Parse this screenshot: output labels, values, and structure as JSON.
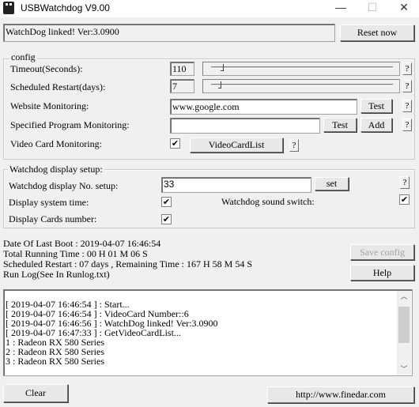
{
  "window": {
    "title": "USBWatchdog V9.00"
  },
  "status": {
    "text": "WatchDog linked! Ver:3.0900",
    "reset_label": "Reset now"
  },
  "config": {
    "label": "config",
    "timeout_label": "Timeout(Seconds):",
    "timeout_value": "110",
    "timeout_slider_fraction": 0.05,
    "restart_label": "Scheduled Restart(days):",
    "restart_value": "7",
    "restart_slider_fraction": 0.04,
    "website_label": "Website Monitoring:",
    "website_value": "www.google.com",
    "website_test": "Test",
    "program_label": "Specified Program Monitoring:",
    "program_value": "",
    "program_test": "Test",
    "program_add": "Add",
    "videocard_label": "Video Card Monitoring:",
    "videocard_checked": true,
    "videocard_list": "VideoCardList",
    "help_q": "?"
  },
  "display": {
    "label": "Watchdog display setup:",
    "no_label": "Watchdog display No. setup:",
    "no_value": "33",
    "set_label": "set",
    "systime_label": "Display system time:",
    "systime_checked": true,
    "sound_label": "Watchdog sound switch:",
    "sound_checked": true,
    "cards_label": "Display Cards number:",
    "cards_checked": true
  },
  "info": {
    "lines": [
      "Date Of Last Boot : 2019-04-07 16:46:54",
      "Total Running Time : 00 H 01 M 06 S",
      "Scheduled Restart : 07 days , Remaining Time : 167 H 58 M 54 S",
      "Run Log(See In Runlog.txt)"
    ],
    "save_label": "Save config",
    "help_label": "Help"
  },
  "log": {
    "lines": [
      "[ 2019-04-07 16:46:54 ] : Start...",
      "[ 2019-04-07 16:46:54 ] : VideoCard Number::6",
      "[ 2019-04-07 16:46:56 ] : WatchDog linked! Ver:3.0900",
      "[ 2019-04-07 16:47:33 ] : GetVideoCardList...",
      "1 : Radeon RX 580 Series",
      "2 : Radeon RX 580 Series",
      "3 : Radeon RX 580 Series"
    ]
  },
  "footer": {
    "clear_label": "Clear",
    "url_label": "http://www.finedar.com"
  }
}
